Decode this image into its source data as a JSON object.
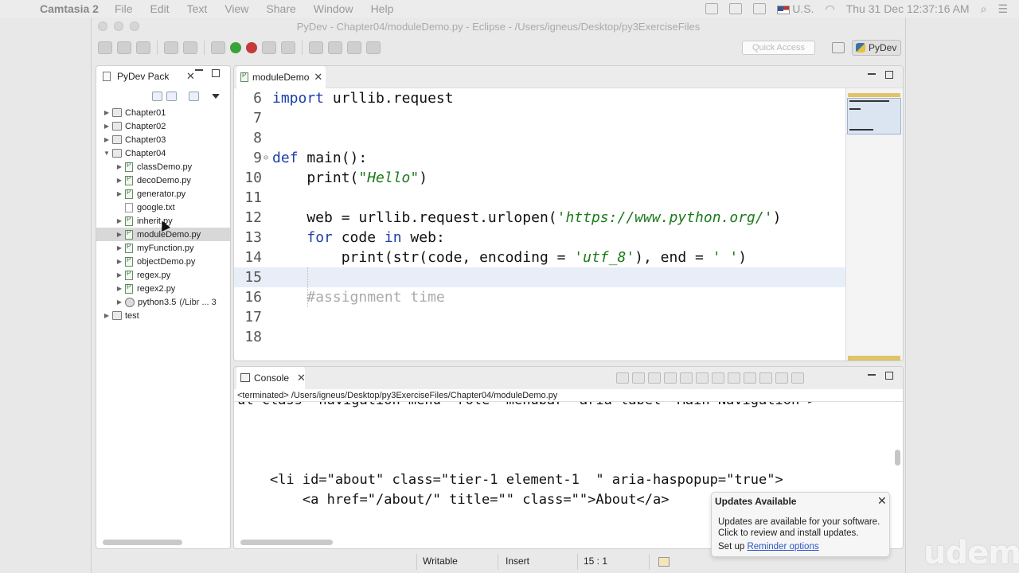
{
  "menubar": {
    "app": "Camtasia 2",
    "items": [
      "File",
      "Edit",
      "Text",
      "View",
      "Share",
      "Window",
      "Help"
    ],
    "locale": "U.S.",
    "clock": "Thu 31 Dec  12:37:16 AM"
  },
  "window": {
    "title": "PyDev - Chapter04/moduleDemo.py - Eclipse - /Users/igneus/Desktop/py3ExerciseFiles",
    "quick_access": "Quick Access",
    "perspective": "PyDev"
  },
  "explorer": {
    "title": "PyDev Pack",
    "items": [
      {
        "label": "Chapter01",
        "level": 0,
        "twisty": "▶"
      },
      {
        "label": "Chapter02",
        "level": 0,
        "twisty": "▶"
      },
      {
        "label": "Chapter03",
        "level": 0,
        "twisty": "▶"
      },
      {
        "label": "Chapter04",
        "level": 0,
        "twisty": "▼"
      },
      {
        "label": "classDemo.py",
        "level": 1,
        "twisty": "▶"
      },
      {
        "label": "decoDemo.py",
        "level": 1,
        "twisty": "▶"
      },
      {
        "label": "generator.py",
        "level": 1,
        "twisty": "▶"
      },
      {
        "label": "google.txt",
        "level": 1,
        "twisty": ""
      },
      {
        "label": "inherit.py",
        "level": 1,
        "twisty": "▶"
      },
      {
        "label": "moduleDemo.py",
        "level": 1,
        "twisty": "▶"
      },
      {
        "label": "myFunction.py",
        "level": 1,
        "twisty": "▶"
      },
      {
        "label": "objectDemo.py",
        "level": 1,
        "twisty": "▶"
      },
      {
        "label": "regex.py",
        "level": 1,
        "twisty": "▶"
      },
      {
        "label": "regex2.py",
        "level": 1,
        "twisty": "▶"
      },
      {
        "label": "python3.5",
        "level": 1,
        "twisty": "▶",
        "suffix": "(/Libr ... 3"
      },
      {
        "label": "test",
        "level": 0,
        "twisty": "▶"
      }
    ]
  },
  "editor": {
    "tab": "moduleDemo",
    "lines": [
      {
        "n": "6",
        "code": "import urllib.request"
      },
      {
        "n": "7",
        "code": ""
      },
      {
        "n": "8",
        "code": ""
      },
      {
        "n": "9",
        "code": "def main():"
      },
      {
        "n": "10",
        "code": "    print(\"Hello\")"
      },
      {
        "n": "11",
        "code": ""
      },
      {
        "n": "12",
        "code": "    web = urllib.request.urlopen('https://www.python.org/')"
      },
      {
        "n": "13",
        "code": "    for code in web:"
      },
      {
        "n": "14",
        "code": "        print(str(code, encoding = 'utf_8'), end = ' ')"
      },
      {
        "n": "15",
        "code": ""
      },
      {
        "n": "16",
        "code": "    #assignment time"
      },
      {
        "n": "17",
        "code": ""
      },
      {
        "n": "18",
        "code": ""
      }
    ]
  },
  "console": {
    "tab": "Console",
    "path": "<terminated> /Users/igneus/Desktop/py3ExerciseFiles/Chapter04/moduleDemo.py",
    "lines": [
      "ul class=\"navigation menu\" role=\"menubar\" aria-label=\"Main Navigation\">",
      "",
      "",
      "",
      "    <li id=\"about\" class=\"tier-1 element-1  \" aria-haspopup=\"true\">",
      "        <a href=\"/about/\" title=\"\" class=\"\">About</a>"
    ]
  },
  "status": {
    "writable": "Writable",
    "insert": "Insert",
    "position": "15 : 1"
  },
  "notification": {
    "title": "Updates Available",
    "body": "Updates are available for your software. Click to review and install updates.",
    "setup": "Set up",
    "link": "Reminder options"
  },
  "watermark": "udemy"
}
